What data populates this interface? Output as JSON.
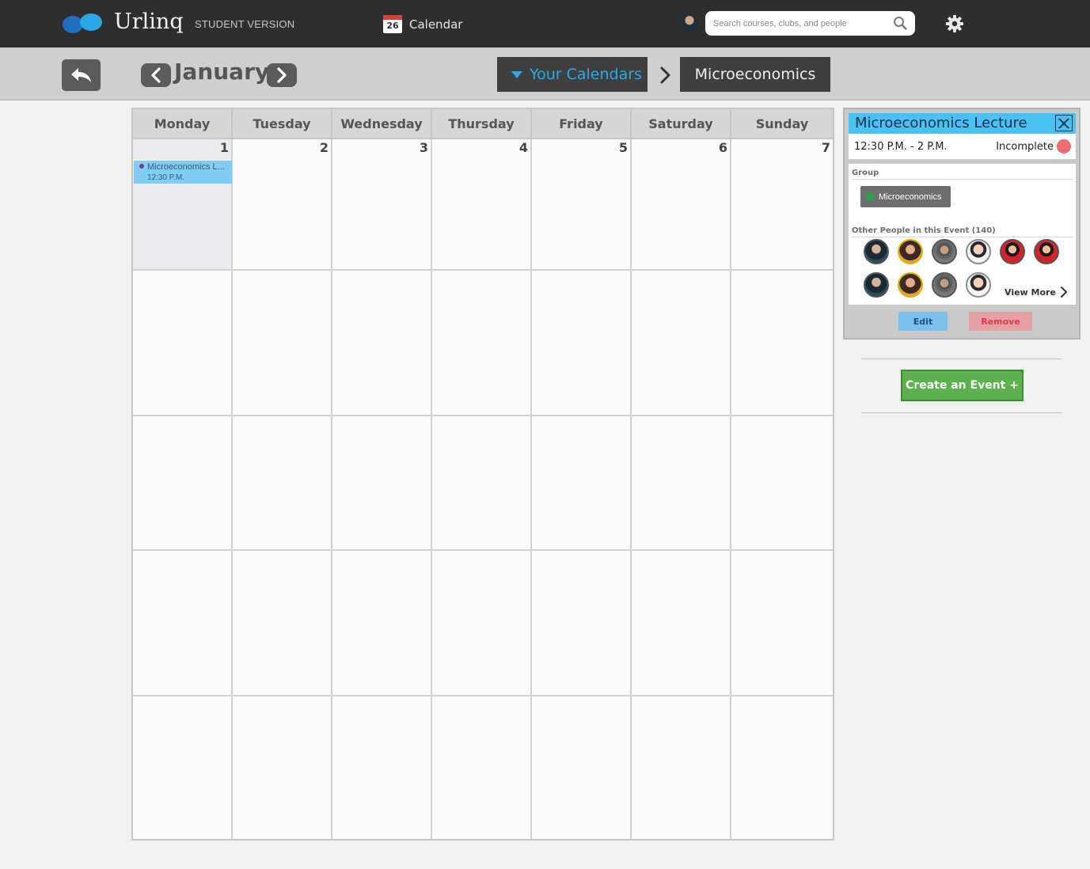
{
  "header": {
    "brand": "Urlinq",
    "version": "STUDENT VERSION",
    "calendar_icon_day": "26",
    "calendar_label": "Calendar",
    "search_placeholder": "Search courses, clubs, and people"
  },
  "toolbar": {
    "month": "January",
    "calendars_label": "Your Calendars",
    "current_calendar": "Microeconomics"
  },
  "calendar": {
    "weekdays": [
      "Monday",
      "Tuesday",
      "Wednesday",
      "Thursday",
      "Friday",
      "Saturday",
      "Sunday"
    ],
    "first_week_days": [
      "1",
      "2",
      "3",
      "4",
      "5",
      "6",
      "7"
    ],
    "event": {
      "title": "Microeconomics L...",
      "time": "12:30 P.M."
    }
  },
  "event_panel": {
    "title": "Microeconomics Lecture",
    "time": "12:30  P.M. - 2 P.M.",
    "status": "Incomplete",
    "group_label": "Group",
    "group_name": "Microeconomics",
    "people_label": "Other People in this Event (140)",
    "view_more": "View More",
    "edit": "Edit",
    "remove": "Remove"
  },
  "actions": {
    "create_event": "Create an Event +"
  },
  "colors": {
    "topbar": "#2e2e2e",
    "accent_blue": "#2da8e8",
    "event_blue": "#82cdf3",
    "panel_header": "#47c2f3",
    "status_incomplete": "#f06b6f",
    "create_green": "#5cb04e",
    "remove_red": "#e2364a"
  },
  "icons": [
    "logo-icon",
    "calendar-icon",
    "search-icon",
    "gear-icon",
    "back-icon",
    "chevron-left-icon",
    "chevron-right-icon",
    "caret-down-icon",
    "close-icon"
  ]
}
